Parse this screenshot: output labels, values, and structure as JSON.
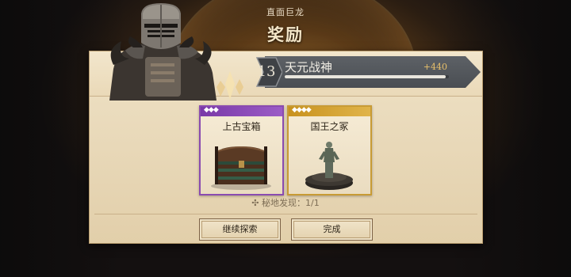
{
  "header": {
    "subtitle": "直面巨龙",
    "title": "奖励"
  },
  "rank": {
    "level": "13",
    "name": "天元战神",
    "xp_gain": "+440",
    "xp_progress": 0.98
  },
  "rewards": [
    {
      "name": "上古宝箱",
      "rarity_icon": "three-diamond-icon",
      "gems": "◆◆◆",
      "color": "#8a4bb0"
    },
    {
      "name": "国王之冢",
      "rarity_icon": "four-diamond-icon",
      "gems": "◆◆◆◆",
      "color": "#c89b35"
    }
  ],
  "discovery_text": "✣ 秘地发现：1/1",
  "buttons": {
    "continue": "继续探索",
    "done": "完成"
  }
}
